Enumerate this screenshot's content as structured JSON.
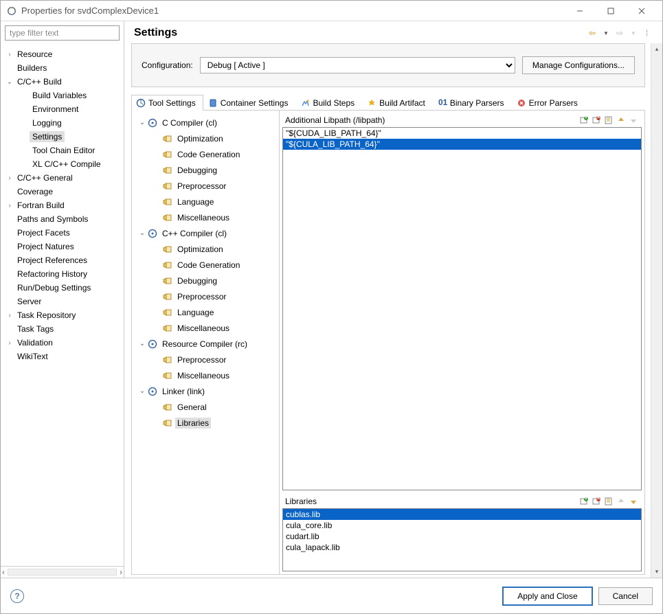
{
  "window": {
    "title": "Properties for svdComplexDevice1"
  },
  "filter": {
    "placeholder": "type filter text"
  },
  "leftTree": [
    {
      "label": "Resource",
      "arrow": ">",
      "indent": 0
    },
    {
      "label": "Builders",
      "arrow": "",
      "indent": 0
    },
    {
      "label": "C/C++ Build",
      "arrow": "v",
      "indent": 0
    },
    {
      "label": "Build Variables",
      "arrow": "",
      "indent": 1
    },
    {
      "label": "Environment",
      "arrow": "",
      "indent": 1
    },
    {
      "label": "Logging",
      "arrow": "",
      "indent": 1
    },
    {
      "label": "Settings",
      "arrow": "",
      "indent": 1,
      "sel": true
    },
    {
      "label": "Tool Chain Editor",
      "arrow": "",
      "indent": 1
    },
    {
      "label": "XL C/C++ Compile",
      "arrow": "",
      "indent": 1
    },
    {
      "label": "C/C++ General",
      "arrow": ">",
      "indent": 0
    },
    {
      "label": "Coverage",
      "arrow": "",
      "indent": 0
    },
    {
      "label": "Fortran Build",
      "arrow": ">",
      "indent": 0
    },
    {
      "label": "Paths and Symbols",
      "arrow": "",
      "indent": 0
    },
    {
      "label": "Project Facets",
      "arrow": "",
      "indent": 0
    },
    {
      "label": "Project Natures",
      "arrow": "",
      "indent": 0
    },
    {
      "label": "Project References",
      "arrow": "",
      "indent": 0
    },
    {
      "label": "Refactoring History",
      "arrow": "",
      "indent": 0
    },
    {
      "label": "Run/Debug Settings",
      "arrow": "",
      "indent": 0
    },
    {
      "label": "Server",
      "arrow": "",
      "indent": 0
    },
    {
      "label": "Task Repository",
      "arrow": ">",
      "indent": 0
    },
    {
      "label": "Task Tags",
      "arrow": "",
      "indent": 0
    },
    {
      "label": "Validation",
      "arrow": ">",
      "indent": 0
    },
    {
      "label": "WikiText",
      "arrow": "",
      "indent": 0
    }
  ],
  "heading": "Settings",
  "config": {
    "label": "Configuration:",
    "selected": "Debug  [ Active ]",
    "manage": "Manage Configurations..."
  },
  "tabs": [
    {
      "label": "Tool Settings",
      "active": true
    },
    {
      "label": "Container Settings"
    },
    {
      "label": "Build Steps"
    },
    {
      "label": "Build Artifact"
    },
    {
      "label": "Binary Parsers"
    },
    {
      "label": "Error Parsers"
    }
  ],
  "toolTree": [
    {
      "label": "C Compiler (cl)",
      "arrow": "v",
      "indent": 0,
      "type": "group"
    },
    {
      "label": "Optimization",
      "indent": 1,
      "type": "opt"
    },
    {
      "label": "Code Generation",
      "indent": 1,
      "type": "opt"
    },
    {
      "label": "Debugging",
      "indent": 1,
      "type": "opt"
    },
    {
      "label": "Preprocessor",
      "indent": 1,
      "type": "opt"
    },
    {
      "label": "Language",
      "indent": 1,
      "type": "opt"
    },
    {
      "label": "Miscellaneous",
      "indent": 1,
      "type": "opt"
    },
    {
      "label": "C++ Compiler (cl)",
      "arrow": "v",
      "indent": 0,
      "type": "group"
    },
    {
      "label": "Optimization",
      "indent": 1,
      "type": "opt"
    },
    {
      "label": "Code Generation",
      "indent": 1,
      "type": "opt"
    },
    {
      "label": "Debugging",
      "indent": 1,
      "type": "opt"
    },
    {
      "label": "Preprocessor",
      "indent": 1,
      "type": "opt"
    },
    {
      "label": "Language",
      "indent": 1,
      "type": "opt"
    },
    {
      "label": "Miscellaneous",
      "indent": 1,
      "type": "opt"
    },
    {
      "label": "Resource Compiler (rc)",
      "arrow": "v",
      "indent": 0,
      "type": "group"
    },
    {
      "label": "Preprocessor",
      "indent": 1,
      "type": "opt"
    },
    {
      "label": "Miscellaneous",
      "indent": 1,
      "type": "opt"
    },
    {
      "label": "Linker (link)",
      "arrow": "v",
      "indent": 0,
      "type": "group"
    },
    {
      "label": "General",
      "indent": 1,
      "type": "opt"
    },
    {
      "label": "Libraries",
      "indent": 1,
      "type": "opt",
      "sel": true
    }
  ],
  "libpath": {
    "title": "Additional Libpath (/libpath)",
    "items": [
      {
        "text": "\"${CUDA_LIB_PATH_64}\"",
        "sel": false
      },
      {
        "text": "\"${CULA_LIB_PATH_64}\"",
        "sel": true
      }
    ]
  },
  "libraries": {
    "title": "Libraries",
    "items": [
      {
        "text": "cublas.lib",
        "sel": true
      },
      {
        "text": "cula_core.lib",
        "sel": false
      },
      {
        "text": "cudart.lib",
        "sel": false
      },
      {
        "text": "cula_lapack.lib",
        "sel": false
      }
    ]
  },
  "footer": {
    "apply": "Apply and Close",
    "cancel": "Cancel"
  }
}
